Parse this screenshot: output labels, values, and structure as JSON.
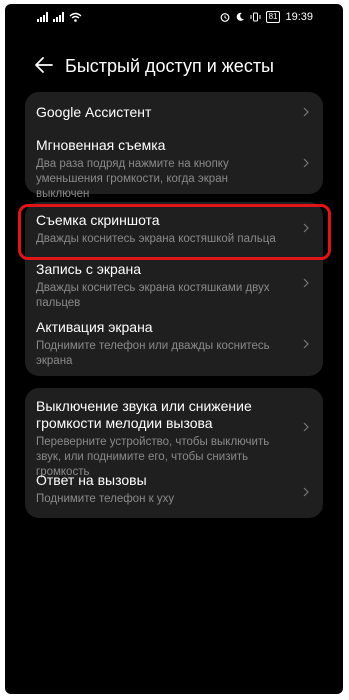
{
  "status_bar": {
    "battery": "81",
    "time": "19:39"
  },
  "header": {
    "title": "Быстрый доступ и жесты"
  },
  "group1": [
    {
      "title": "Google Ассистент",
      "subtitle": ""
    },
    {
      "title": "Мгновенная съемка",
      "subtitle": "Два раза подряд нажмите на кнопку уменьшения громкости, когда экран выключен"
    }
  ],
  "group2": [
    {
      "title": "Съемка скриншота",
      "subtitle": "Дважды коснитесь экрана костяшкой пальца"
    },
    {
      "title": "Запись с экрана",
      "subtitle": "Дважды коснитесь экрана костяшками двух пальцев"
    },
    {
      "title": "Активация экрана",
      "subtitle": "Поднимите телефон или дважды коснитесь экрана"
    }
  ],
  "group3": [
    {
      "title": "Выключение звука или снижение громкости мелодии вызова",
      "subtitle": "Переверните устройство, чтобы выключить звук, или поднимите его, чтобы снизить громкость"
    },
    {
      "title": "Ответ на вызовы",
      "subtitle": "Поднимите телефон к уху"
    }
  ]
}
